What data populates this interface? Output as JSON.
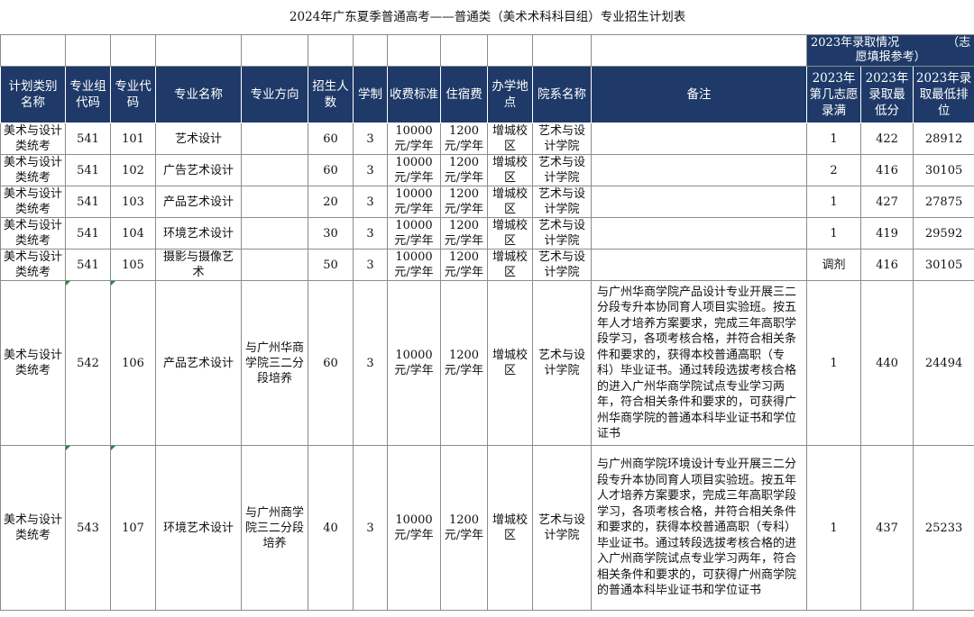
{
  "title": "2024年广东夏季普通高考——普通类（美术术科科目组）专业招生计划表",
  "history_header": {
    "left": "2023年录取情况",
    "right": "（志",
    "line2": "愿填报参考）"
  },
  "headers": [
    "计划类别名称",
    "专业组代码",
    "专业代码",
    "专业名称",
    "专业方向",
    "招生人数",
    "学制",
    "收费标准",
    "住宿费",
    "办学地点",
    "院系名称",
    "备注",
    "2023年第几志愿录满",
    "2023年录取最低分",
    "2023年录取最低排位"
  ],
  "rows": [
    {
      "category": "美术与设计类统考",
      "group": "541",
      "code": "101",
      "name": "艺术设计",
      "direction": "",
      "count": "60",
      "years": "3",
      "fee": "10000元/学年",
      "dorm": "1200元/学年",
      "campus": "增城校区",
      "dept": "艺术与设计学院",
      "note": "",
      "choice": "1",
      "min_score": "422",
      "min_rank": "28912"
    },
    {
      "category": "美术与设计类统考",
      "group": "541",
      "code": "102",
      "name": "广告艺术设计",
      "direction": "",
      "count": "60",
      "years": "3",
      "fee": "10000元/学年",
      "dorm": "1200元/学年",
      "campus": "增城校区",
      "dept": "艺术与设计学院",
      "note": "",
      "choice": "2",
      "min_score": "416",
      "min_rank": "30105"
    },
    {
      "category": "美术与设计类统考",
      "group": "541",
      "code": "103",
      "name": "产品艺术设计",
      "direction": "",
      "count": "20",
      "years": "3",
      "fee": "10000元/学年",
      "dorm": "1200元/学年",
      "campus": "增城校区",
      "dept": "艺术与设计学院",
      "note": "",
      "choice": "1",
      "min_score": "427",
      "min_rank": "27875"
    },
    {
      "category": "美术与设计类统考",
      "group": "541",
      "code": "104",
      "name": "环境艺术设计",
      "direction": "",
      "count": "30",
      "years": "3",
      "fee": "10000元/学年",
      "dorm": "1200元/学年",
      "campus": "增城校区",
      "dept": "艺术与设计学院",
      "note": "",
      "choice": "1",
      "min_score": "419",
      "min_rank": "29592"
    },
    {
      "category": "美术与设计类统考",
      "group": "541",
      "code": "105",
      "name": "摄影与摄像艺术",
      "direction": "",
      "count": "50",
      "years": "3",
      "fee": "10000元/学年",
      "dorm": "1200元/学年",
      "campus": "增城校区",
      "dept": "艺术与设计学院",
      "note": "",
      "choice": "调剂",
      "min_score": "416",
      "min_rank": "30105"
    },
    {
      "category": "美术与设计类统考",
      "group": "542",
      "code": "106",
      "name": "产品艺术设计",
      "direction": "与广州华商学院三二分段培养",
      "count": "60",
      "years": "3",
      "fee": "10000元/学年",
      "dorm": "1200元/学年",
      "campus": "增城校区",
      "dept": "艺术与设计学院",
      "note": "与广州华商学院产品设计专业开展三二分段专升本协同育人项目实验班。按五年人才培养方案要求，完成三年高职学段学习，各项考核合格，并符合相关条件和要求的，获得本校普通高职（专科）毕业证书。通过转段选拔考核合格的进入广州华商学院试点专业学习两年，符合相关条件和要求的，可获得广州华商学院的普通本科毕业证书和学位证书",
      "choice": "1",
      "min_score": "440",
      "min_rank": "24494"
    },
    {
      "category": "美术与设计类统考",
      "group": "543",
      "code": "107",
      "name": "环境艺术设计",
      "direction": "与广州商学院三二分段培养",
      "count": "40",
      "years": "3",
      "fee": "10000元/学年",
      "dorm": "1200元/学年",
      "campus": "增城校区",
      "dept": "艺术与设计学院",
      "note": "与广州商学院环境设计专业开展三二分段专升本协同育人项目实验班。按五年人才培养方案要求，完成三年高职学段学习，各项考核合格，并符合相关条件和要求的，获得本校普通高职（专科）毕业证书。通过转段选拔考核合格的进入广州商学院试点专业学习两年，符合相关条件和要求的，可获得广州商学院的普通本科毕业证书和学位证书",
      "choice": "1",
      "min_score": "437",
      "min_rank": "25233"
    }
  ]
}
